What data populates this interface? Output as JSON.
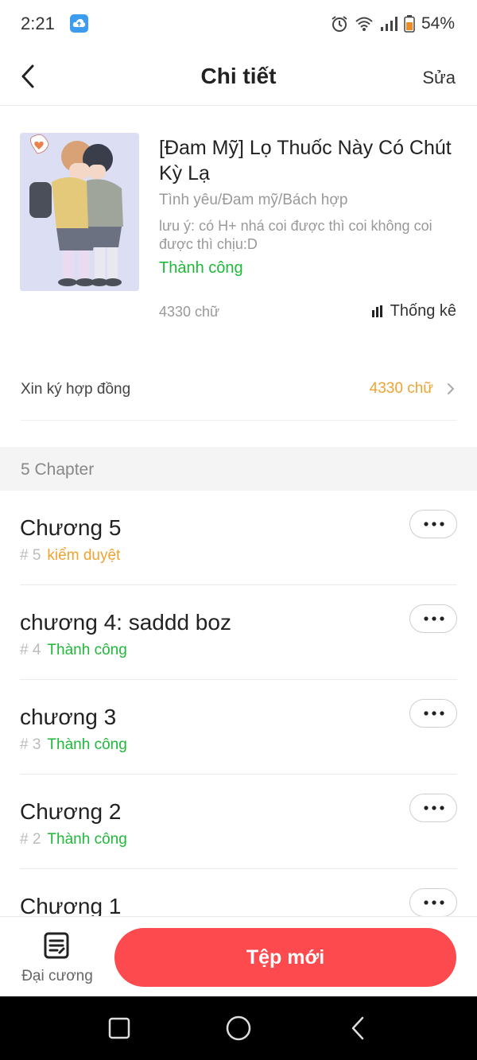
{
  "status_bar": {
    "time": "2:21",
    "battery": "54%",
    "icons": [
      "cloud-app-icon",
      "alarm-icon",
      "wifi-icon",
      "signal-icon",
      "battery-icon"
    ]
  },
  "header": {
    "title": "Chi tiết",
    "edit_label": "Sửa",
    "back_icon": "chevron-left-icon"
  },
  "book": {
    "title": "[Đam Mỹ] Lọ Thuốc Này Có Chút Kỳ Lạ",
    "genre": "Tình yêu/Đam mỹ/Bách hợp",
    "note": "lưu ý: có H+ nhá coi được thì coi không coi được thì chịu:D",
    "status": "Thành công",
    "word_count": "4330 chữ",
    "stats_label": "Thống kê",
    "cover_icon": "book-cover-image"
  },
  "contract": {
    "label": "Xin ký hợp đồng",
    "value": "4330 chữ"
  },
  "section": {
    "title": "5 Chapter"
  },
  "chapters": [
    {
      "title": "Chương 5",
      "num": "# 5",
      "status": "kiểm duyệt",
      "status_type": "review"
    },
    {
      "title": "chương 4: saddd boz",
      "num": "# 4",
      "status": "Thành công",
      "status_type": "ok"
    },
    {
      "title": "chương 3",
      "num": "# 3",
      "status": "Thành công",
      "status_type": "ok"
    },
    {
      "title": "Chương 2",
      "num": "# 2",
      "status": "Thành công",
      "status_type": "ok"
    },
    {
      "title": "Chương 1",
      "num": "",
      "status": "",
      "status_type": "ok"
    }
  ],
  "bottom": {
    "outline_label": "Đại cương",
    "new_file_label": "Tệp mới"
  },
  "colors": {
    "accent_red": "#fc4a4e",
    "success_green": "#1fb93a",
    "warning_orange": "#f0a330"
  }
}
